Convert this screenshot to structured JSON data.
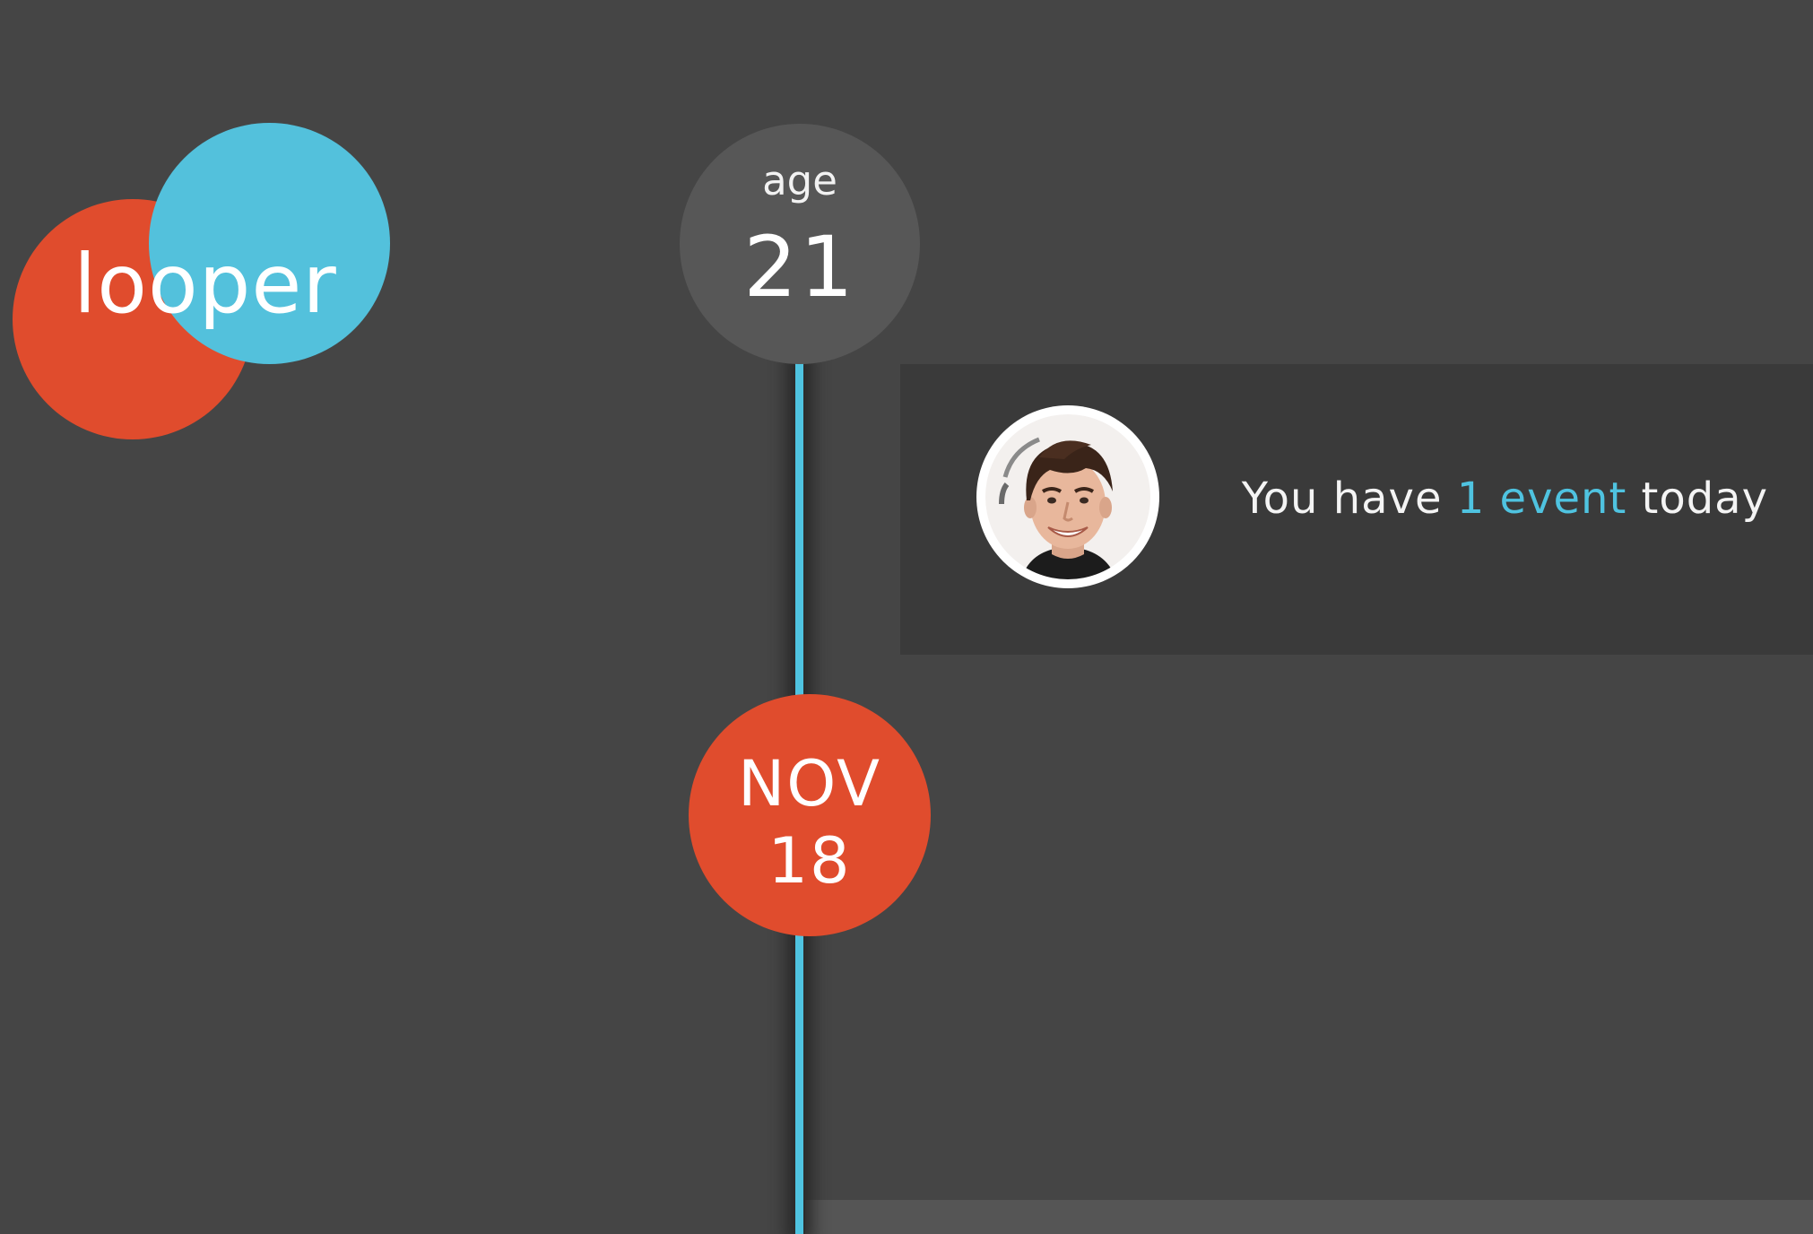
{
  "logo": {
    "text": "looper"
  },
  "age": {
    "label": "age",
    "value": "21"
  },
  "event_notice": {
    "prefix": "You have ",
    "highlight": "1 event",
    "suffix": " today"
  },
  "date": {
    "month": "NOV",
    "day": "18"
  },
  "colors": {
    "background": "#454545",
    "accent_orange": "#e04c2d",
    "accent_blue": "#53c1dc",
    "panel": "#3a3a3a",
    "age_circle": "#575757"
  },
  "icons": {
    "avatar": "user-avatar-photo"
  }
}
